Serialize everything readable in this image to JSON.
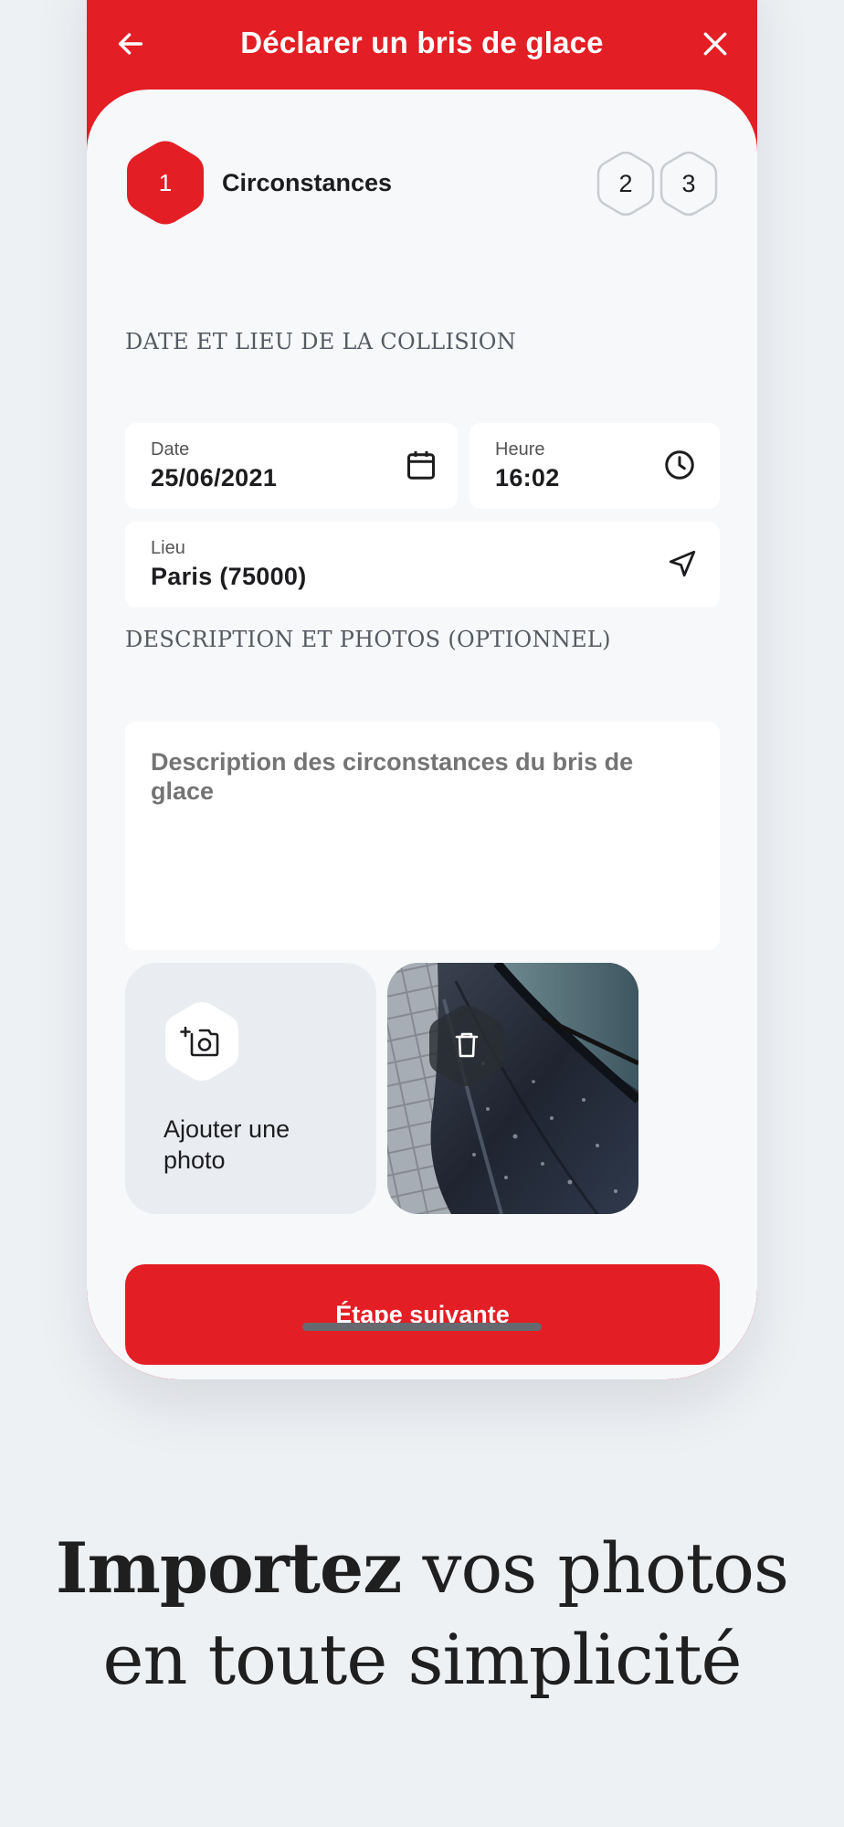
{
  "header": {
    "title": "Déclarer un bris de glace"
  },
  "steps": {
    "current_number": "1",
    "current_label": "Circonstances",
    "step2": "2",
    "step3": "3"
  },
  "section1": {
    "title": "DATE ET LIEU DE LA COLLISION"
  },
  "fields": {
    "date": {
      "label": "Date",
      "value": "25/06/2021"
    },
    "heure": {
      "label": "Heure",
      "value": "16:02"
    },
    "lieu": {
      "label": "Lieu",
      "value": "Paris (75000)"
    }
  },
  "section2": {
    "title": "DESCRIPTION ET PHOTOS (OPTIONNEL)"
  },
  "description": {
    "placeholder": "Description des circonstances du bris de glace"
  },
  "photos": {
    "add_label": "Ajouter une photo"
  },
  "next_button": "Étape suivante",
  "tagline": {
    "bold": "Importez",
    "rest1": " vos photos",
    "line2": "en toute simplicité"
  },
  "colors": {
    "brand": "#e31e24",
    "background": "#eef1f4",
    "sheet": "#f6f8fa"
  }
}
